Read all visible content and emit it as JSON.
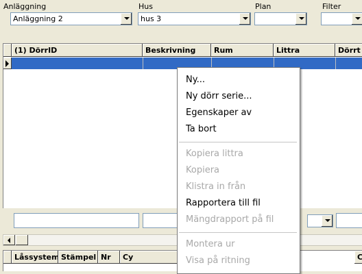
{
  "filters": {
    "anlaggning": {
      "label": "Anläggning",
      "value": "Anläggning 2"
    },
    "hus": {
      "label": "Hus",
      "value": "hus 3"
    },
    "plan": {
      "label": "Plan",
      "value": ""
    },
    "filter": {
      "label": "Filter",
      "value": ""
    }
  },
  "grid": {
    "columns": [
      "(1) DörrID",
      "Beskrivning",
      "Rum",
      "Littra",
      "Dörrt"
    ]
  },
  "bottom_grid": {
    "columns": [
      "Låssystem",
      "Stämpel",
      "Nr",
      "Cy",
      "C"
    ]
  },
  "context_menu": {
    "items": [
      {
        "label": "Ny...",
        "enabled": true
      },
      {
        "label": "Ny dörr serie...",
        "enabled": true
      },
      {
        "label": "Egenskaper av",
        "enabled": true
      },
      {
        "label": "Ta bort",
        "enabled": true
      },
      {
        "label": "Kopiera littra",
        "enabled": false
      },
      {
        "label": "Kopiera",
        "enabled": false
      },
      {
        "label": "Klistra in från",
        "enabled": false
      },
      {
        "label": "Rapportera till fil",
        "enabled": true
      },
      {
        "label": "Mängdrapport på fil",
        "enabled": false
      },
      {
        "label": "Montera ur",
        "enabled": false
      },
      {
        "label": "Visa på ritning",
        "enabled": false
      }
    ]
  },
  "colors": {
    "selection": "#316ac5",
    "window_bg": "#ece9d8"
  }
}
